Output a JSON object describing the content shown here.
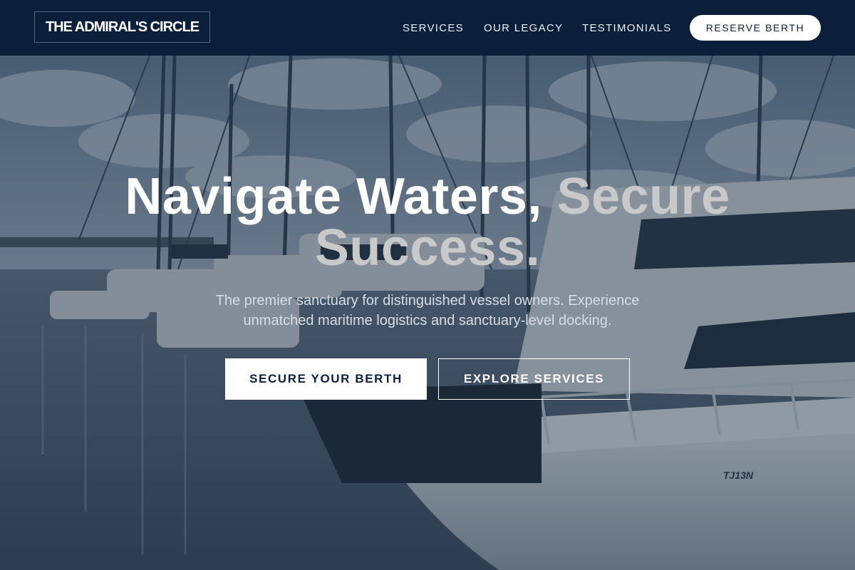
{
  "brand": {
    "logo_text": "THE ADMIRAL'S CIRCLE"
  },
  "nav": {
    "items": [
      {
        "label": "SERVICES"
      },
      {
        "label": "OUR LEGACY"
      },
      {
        "label": "TESTIMONIALS"
      }
    ],
    "cta_label": "RESERVE BERTH"
  },
  "hero": {
    "headline_part1": "Navigate Waters,",
    "headline_accent1": "Secure",
    "headline_accent2": "Success.",
    "subtitle": "The premier sanctuary for distinguished vessel owners. Experience unmatched maritime logistics and sanctuary-level docking.",
    "primary_button": "SECURE YOUR BERTH",
    "secondary_button": "EXPLORE SERVICES",
    "hull_marking": "TJ13N"
  },
  "colors": {
    "navy": "#0c1f3a",
    "accent_text": "#c9c9c9",
    "white": "#ffffff"
  }
}
